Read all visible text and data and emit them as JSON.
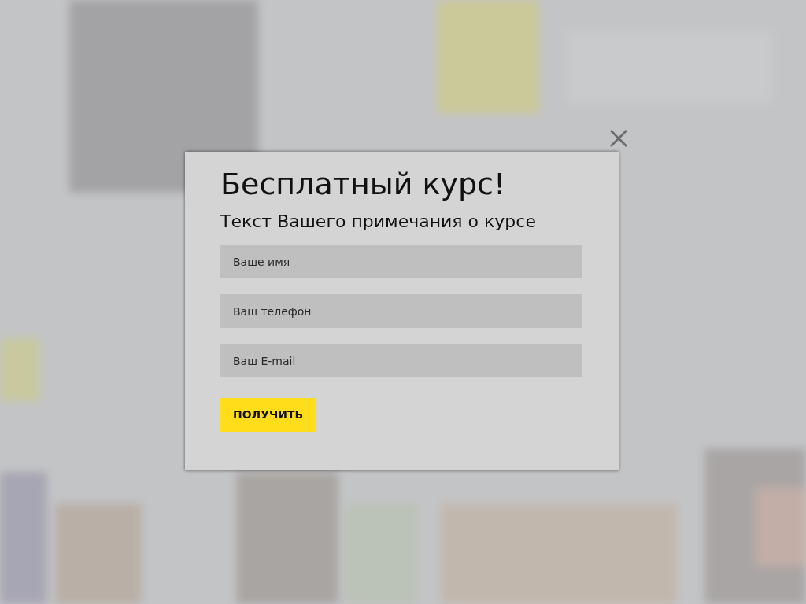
{
  "dialog": {
    "title": "Бесплатный курс!",
    "subtitle": "Текст Вашего примечания о курсе",
    "fields": [
      {
        "placeholder": "Ваше имя"
      },
      {
        "placeholder": "Ваш телефон"
      },
      {
        "placeholder": "Ваш E-mail"
      }
    ],
    "submit": "ПОЛУЧИТЬ"
  }
}
